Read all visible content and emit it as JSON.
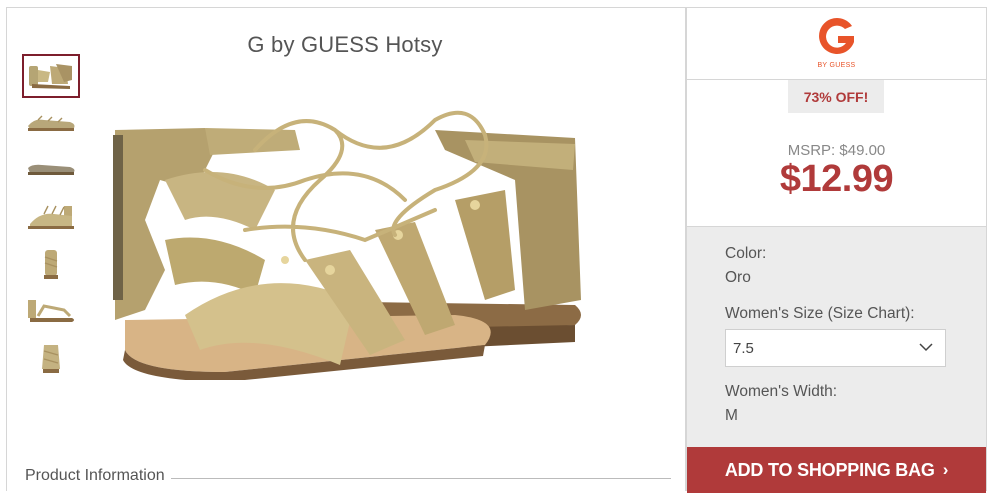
{
  "product": {
    "brand": "G by GUESS",
    "name": "Hotsy"
  },
  "brand_logo": {
    "letter": "G",
    "caption": "BY GUESS",
    "color": "#e8542a"
  },
  "discount": {
    "label": "73% OFF!"
  },
  "pricing": {
    "msrp_label": "MSRP: $49.00",
    "price": "$12.99",
    "accent_color": "#b03a3a"
  },
  "options": {
    "color_label": "Color:",
    "color_value": "Oro",
    "size_label": "Women's Size (Size Chart):",
    "size_value": "7.5",
    "width_label": "Women's Width:",
    "width_value": "M"
  },
  "cta": {
    "label": "ADD TO SHOPPING BAG",
    "arrow": "›"
  },
  "product_info": {
    "label": "Product Information"
  },
  "thumbnails": [
    {
      "name": "pair-front-view",
      "selected": true
    },
    {
      "name": "side-view"
    },
    {
      "name": "sole-view"
    },
    {
      "name": "outer-side-view"
    },
    {
      "name": "back-view"
    },
    {
      "name": "top-view"
    },
    {
      "name": "heel-view"
    }
  ]
}
